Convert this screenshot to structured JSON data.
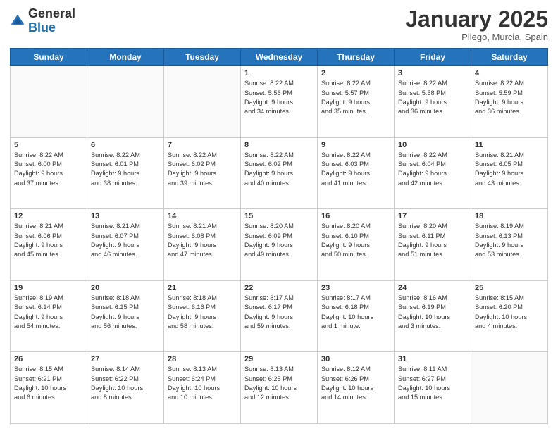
{
  "header": {
    "logo_general": "General",
    "logo_blue": "Blue",
    "month": "January 2025",
    "location": "Pliego, Murcia, Spain"
  },
  "days_of_week": [
    "Sunday",
    "Monday",
    "Tuesday",
    "Wednesday",
    "Thursday",
    "Friday",
    "Saturday"
  ],
  "weeks": [
    [
      {
        "day": "",
        "info": ""
      },
      {
        "day": "",
        "info": ""
      },
      {
        "day": "",
        "info": ""
      },
      {
        "day": "1",
        "info": "Sunrise: 8:22 AM\nSunset: 5:56 PM\nDaylight: 9 hours\nand 34 minutes."
      },
      {
        "day": "2",
        "info": "Sunrise: 8:22 AM\nSunset: 5:57 PM\nDaylight: 9 hours\nand 35 minutes."
      },
      {
        "day": "3",
        "info": "Sunrise: 8:22 AM\nSunset: 5:58 PM\nDaylight: 9 hours\nand 36 minutes."
      },
      {
        "day": "4",
        "info": "Sunrise: 8:22 AM\nSunset: 5:59 PM\nDaylight: 9 hours\nand 36 minutes."
      }
    ],
    [
      {
        "day": "5",
        "info": "Sunrise: 8:22 AM\nSunset: 6:00 PM\nDaylight: 9 hours\nand 37 minutes."
      },
      {
        "day": "6",
        "info": "Sunrise: 8:22 AM\nSunset: 6:01 PM\nDaylight: 9 hours\nand 38 minutes."
      },
      {
        "day": "7",
        "info": "Sunrise: 8:22 AM\nSunset: 6:02 PM\nDaylight: 9 hours\nand 39 minutes."
      },
      {
        "day": "8",
        "info": "Sunrise: 8:22 AM\nSunset: 6:02 PM\nDaylight: 9 hours\nand 40 minutes."
      },
      {
        "day": "9",
        "info": "Sunrise: 8:22 AM\nSunset: 6:03 PM\nDaylight: 9 hours\nand 41 minutes."
      },
      {
        "day": "10",
        "info": "Sunrise: 8:22 AM\nSunset: 6:04 PM\nDaylight: 9 hours\nand 42 minutes."
      },
      {
        "day": "11",
        "info": "Sunrise: 8:21 AM\nSunset: 6:05 PM\nDaylight: 9 hours\nand 43 minutes."
      }
    ],
    [
      {
        "day": "12",
        "info": "Sunrise: 8:21 AM\nSunset: 6:06 PM\nDaylight: 9 hours\nand 45 minutes."
      },
      {
        "day": "13",
        "info": "Sunrise: 8:21 AM\nSunset: 6:07 PM\nDaylight: 9 hours\nand 46 minutes."
      },
      {
        "day": "14",
        "info": "Sunrise: 8:21 AM\nSunset: 6:08 PM\nDaylight: 9 hours\nand 47 minutes."
      },
      {
        "day": "15",
        "info": "Sunrise: 8:20 AM\nSunset: 6:09 PM\nDaylight: 9 hours\nand 49 minutes."
      },
      {
        "day": "16",
        "info": "Sunrise: 8:20 AM\nSunset: 6:10 PM\nDaylight: 9 hours\nand 50 minutes."
      },
      {
        "day": "17",
        "info": "Sunrise: 8:20 AM\nSunset: 6:11 PM\nDaylight: 9 hours\nand 51 minutes."
      },
      {
        "day": "18",
        "info": "Sunrise: 8:19 AM\nSunset: 6:13 PM\nDaylight: 9 hours\nand 53 minutes."
      }
    ],
    [
      {
        "day": "19",
        "info": "Sunrise: 8:19 AM\nSunset: 6:14 PM\nDaylight: 9 hours\nand 54 minutes."
      },
      {
        "day": "20",
        "info": "Sunrise: 8:18 AM\nSunset: 6:15 PM\nDaylight: 9 hours\nand 56 minutes."
      },
      {
        "day": "21",
        "info": "Sunrise: 8:18 AM\nSunset: 6:16 PM\nDaylight: 9 hours\nand 58 minutes."
      },
      {
        "day": "22",
        "info": "Sunrise: 8:17 AM\nSunset: 6:17 PM\nDaylight: 9 hours\nand 59 minutes."
      },
      {
        "day": "23",
        "info": "Sunrise: 8:17 AM\nSunset: 6:18 PM\nDaylight: 10 hours\nand 1 minute."
      },
      {
        "day": "24",
        "info": "Sunrise: 8:16 AM\nSunset: 6:19 PM\nDaylight: 10 hours\nand 3 minutes."
      },
      {
        "day": "25",
        "info": "Sunrise: 8:15 AM\nSunset: 6:20 PM\nDaylight: 10 hours\nand 4 minutes."
      }
    ],
    [
      {
        "day": "26",
        "info": "Sunrise: 8:15 AM\nSunset: 6:21 PM\nDaylight: 10 hours\nand 6 minutes."
      },
      {
        "day": "27",
        "info": "Sunrise: 8:14 AM\nSunset: 6:22 PM\nDaylight: 10 hours\nand 8 minutes."
      },
      {
        "day": "28",
        "info": "Sunrise: 8:13 AM\nSunset: 6:24 PM\nDaylight: 10 hours\nand 10 minutes."
      },
      {
        "day": "29",
        "info": "Sunrise: 8:13 AM\nSunset: 6:25 PM\nDaylight: 10 hours\nand 12 minutes."
      },
      {
        "day": "30",
        "info": "Sunrise: 8:12 AM\nSunset: 6:26 PM\nDaylight: 10 hours\nand 14 minutes."
      },
      {
        "day": "31",
        "info": "Sunrise: 8:11 AM\nSunset: 6:27 PM\nDaylight: 10 hours\nand 15 minutes."
      },
      {
        "day": "",
        "info": ""
      }
    ]
  ]
}
